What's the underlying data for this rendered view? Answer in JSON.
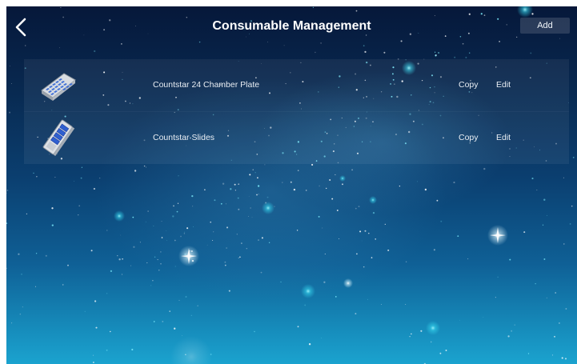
{
  "header": {
    "title": "Consumable Management",
    "add_label": "Add",
    "back_icon": "chevron-left-icon"
  },
  "consumables": [
    {
      "name": "Countstar 24 Chamber Plate",
      "icon": "chamber-plate-icon",
      "copy_label": "Copy",
      "edit_label": "Edit"
    },
    {
      "name": "Countstar Slides",
      "icon": "slide-icon",
      "copy_label": "Copy",
      "edit_label": "Edit"
    }
  ],
  "colors": {
    "background_top": "#06183a",
    "background_bottom": "#1ba3cf",
    "row_background": "rgba(255,255,255,0.06)",
    "star_glow": "#4fe6ff",
    "text": "#e9eef4"
  }
}
